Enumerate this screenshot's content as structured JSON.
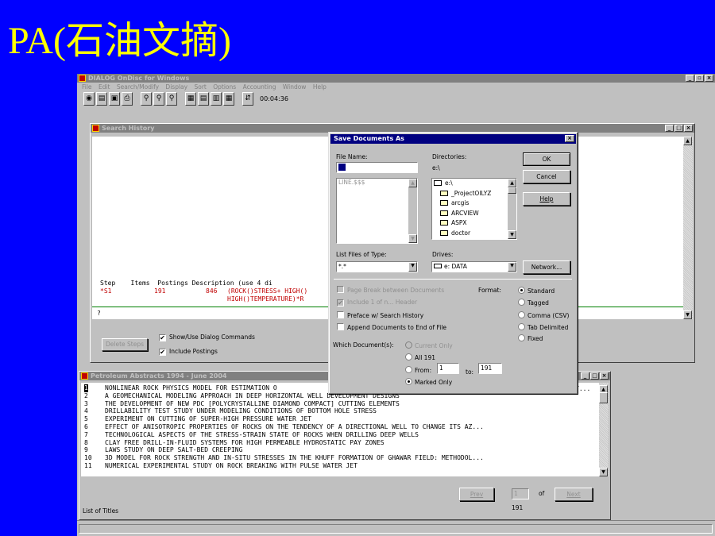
{
  "slide": {
    "title": "PA(石油文摘)"
  },
  "app": {
    "title": "DIALOG OnDisc for Windows",
    "menu": [
      "File",
      "Edit",
      "Search/Modify",
      "Display",
      "Sort",
      "Options",
      "Accounting",
      "Window",
      "Help"
    ],
    "timer": "00:04:36"
  },
  "search_history": {
    "title": "Search History",
    "header": "Step    Items  Postings Description (use 4 di",
    "row1_step": "*S1",
    "row1_items": "191",
    "row1_postings": "846",
    "row1_desc": "(ROCK()STRESS+ HIGH()",
    "row1_desc2": "HIGH()TEMPERATURE)*R",
    "input": "?",
    "delete_steps": "Delete Steps",
    "show_dialog": "Show/Use Dialog Commands",
    "include_postings": "Include Postings"
  },
  "results": {
    "title": "Petroleum Abstracts 1994 - June 2004",
    "rows": [
      {
        "n": "1",
        "t": "NONLINEAR ROCK PHYSICS MODEL FOR ESTIMATION O"
      },
      {
        "n": "2",
        "t": "A GEOMECHANICAL MODELING APPROACH IN DEEP HORIZONTAL WELL DEVELOPMENT DESIGNS"
      },
      {
        "n": "3",
        "t": "THE DEVELOPMENT OF NEW PDC [POLYCRYSTALLINE DIAMOND COMPACT] CUTTING ELEMENTS"
      },
      {
        "n": "4",
        "t": "DRILLABILITY TEST STUDY UNDER MODELING CONDITIONS OF BOTTOM HOLE STRESS"
      },
      {
        "n": "5",
        "t": "EXPERIMENT ON CUTTING OF SUPER-HIGH PRESSURE WATER JET"
      },
      {
        "n": "6",
        "t": "EFFECT OF ANISOTROPIC PROPERTIES OF ROCKS ON THE TENDENCY OF A DIRECTIONAL WELL TO CHANGE ITS AZ..."
      },
      {
        "n": "7",
        "t": "TECHNOLOGICAL ASPECTS OF THE STRESS-STRAIN STATE OF ROCKS WHEN DRILLING DEEP WELLS"
      },
      {
        "n": "8",
        "t": "CLAY FREE DRILL-IN-FLUID SYSTEMS FOR HIGH PERMEABLE HYDROSTATIC PAY ZONES"
      },
      {
        "n": "9",
        "t": "LAWS STUDY ON DEEP SALT-BED CREEPING"
      },
      {
        "n": "10",
        "t": "3D MODEL FOR ROCK STRENGTH AND IN-SITU STRESSES IN THE KHUFF FORMATION OF GHAWAR FIELD: METHODOL..."
      },
      {
        "n": "11",
        "t": "NUMERICAL EXPERIMENTAL STUDY ON ROCK BREAKING WITH PULSE WATER JET"
      }
    ],
    "row1_tail": "T...",
    "prev": "Prev",
    "next": "Next",
    "page": "1",
    "of": "of",
    "total": "191",
    "footer": "List of Titles"
  },
  "dialog": {
    "title": "Save Documents As",
    "file_name_label": "File Name:",
    "file_list": [
      "LINE.$$$"
    ],
    "directories_label": "Directories:",
    "current_dir": "e:\\",
    "dirs": [
      "e:\\",
      "_ProjectOILYZ",
      "arcgis",
      "ARCVIEW",
      "ASPX",
      "doctor"
    ],
    "ok": "OK",
    "cancel": "Cancel",
    "help": "Help",
    "file_type_label": "List Files of Type:",
    "file_type": "*.*",
    "drives_label": "Drives:",
    "drive": "e: DATA",
    "network": "Network...",
    "page_break": "Page Break between Documents",
    "include_header": "Include 1 of n... Header",
    "preface": "Preface w/ Search History",
    "append": "Append Documents to End of File",
    "format_label": "Format:",
    "formats": [
      "Standard",
      "Tagged",
      "Comma (CSV)",
      "Tab Delimited",
      "Fixed"
    ],
    "which_label": "Which Document(s):",
    "current_only": "Current Only",
    "all": "All 191",
    "from": "From:",
    "from_val": "1",
    "to": "to:",
    "to_val": "191",
    "marked_only": "Marked Only"
  }
}
